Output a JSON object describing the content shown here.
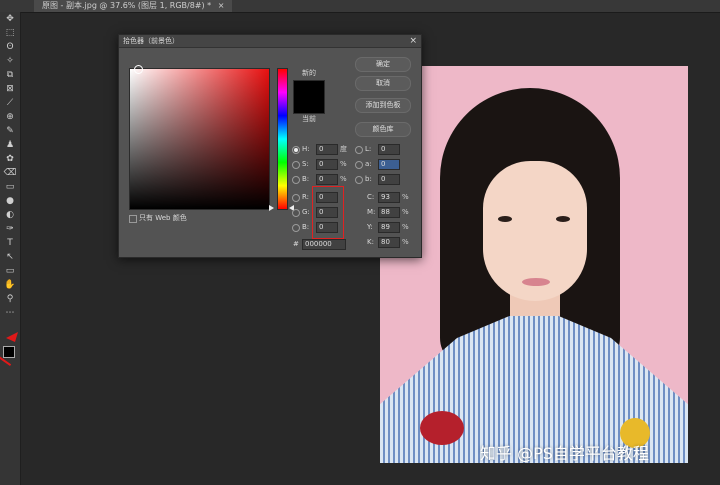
{
  "tab": {
    "title": "原图 - 副本.jpg @ 37.6% (图层 1, RGB/8#) *",
    "close": "×"
  },
  "tools": [
    "✥",
    "⬚",
    "ʘ",
    "✧",
    "⧉",
    "⊠",
    "⟋",
    "⊕",
    "✎",
    "♟",
    "✿",
    "⌫",
    "▭",
    "●",
    "◐",
    "✑",
    "T",
    "↖",
    "▭",
    "✋",
    "⚲",
    "⋯"
  ],
  "dialog": {
    "title": "拾色器（前景色）",
    "close": "×",
    "new_label": "新的",
    "current_label": "当前",
    "buttons": {
      "ok": "确定",
      "cancel": "取消",
      "add_swatch": "添加到色板",
      "libraries": "颜色库"
    },
    "hsb": [
      {
        "label": "H:",
        "value": "0",
        "unit": "度",
        "selected": true
      },
      {
        "label": "S:",
        "value": "0",
        "unit": "%"
      },
      {
        "label": "B:",
        "value": "0",
        "unit": "%"
      }
    ],
    "rgb": [
      {
        "label": "R:",
        "value": "0"
      },
      {
        "label": "G:",
        "value": "0"
      },
      {
        "label": "B:",
        "value": "0"
      }
    ],
    "lab": [
      {
        "label": "L:",
        "value": "0"
      },
      {
        "label": "a:",
        "value": "0"
      },
      {
        "label": "b:",
        "value": "0"
      }
    ],
    "cmyk": [
      {
        "label": "C:",
        "value": "93",
        "unit": "%"
      },
      {
        "label": "M:",
        "value": "88",
        "unit": "%"
      },
      {
        "label": "Y:",
        "value": "89",
        "unit": "%"
      },
      {
        "label": "K:",
        "value": "80",
        "unit": "%"
      }
    ],
    "hex_label": "#",
    "hex_value": "000000",
    "web_only": "只有 Web 颜色"
  },
  "watermark": "知乎 @PS自学平台教程",
  "colors": {
    "foreground": "#000000",
    "background": "#ffffff",
    "photo_bg": "#eeb8c8",
    "annotation": "#e01919"
  }
}
